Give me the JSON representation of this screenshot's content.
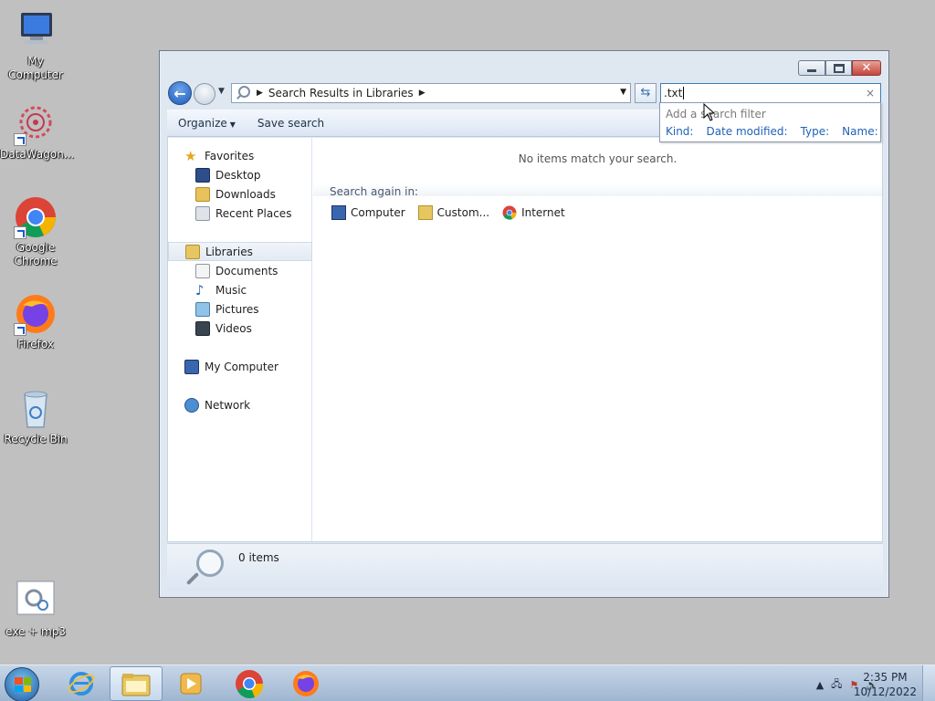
{
  "desktop": {
    "icons": [
      {
        "label": "My Computer",
        "icon": "computer-icon"
      },
      {
        "label": "DataWagon...",
        "icon": "datawagon-icon"
      },
      {
        "label": "Google Chrome",
        "icon": "chrome-icon"
      },
      {
        "label": "Firefox",
        "icon": "firefox-icon"
      },
      {
        "label": "Recycle Bin",
        "icon": "recycle-bin-icon"
      },
      {
        "label": "exe + mp3",
        "icon": "settings-file-icon"
      }
    ]
  },
  "window": {
    "address": {
      "crumb": "Search Results in Libraries"
    },
    "search": {
      "value": ".txt",
      "clear": "×"
    },
    "suggestions": {
      "hint": "Add a search filter",
      "filters": [
        "Kind:",
        "Date modified:",
        "Type:",
        "Name:"
      ]
    },
    "toolbar": {
      "organize": "Organize",
      "save_search": "Save search"
    },
    "navpane": {
      "favorites": "Favorites",
      "desktop": "Desktop",
      "downloads": "Downloads",
      "recent_places": "Recent Places",
      "libraries": "Libraries",
      "documents": "Documents",
      "music": "Music",
      "pictures": "Pictures",
      "videos": "Videos",
      "my_computer": "My Computer",
      "network": "Network"
    },
    "content": {
      "no_items": "No items match your search.",
      "search_again": "Search again in:",
      "options": [
        "Computer",
        "Custom...",
        "Internet"
      ]
    },
    "details": {
      "count": "0 items"
    }
  },
  "taskbar": {
    "time": "2:35 PM",
    "date": "10/12/2022"
  },
  "colors": {
    "desktop_bg": "#c0c0c0",
    "accent": "#1f62b8"
  }
}
